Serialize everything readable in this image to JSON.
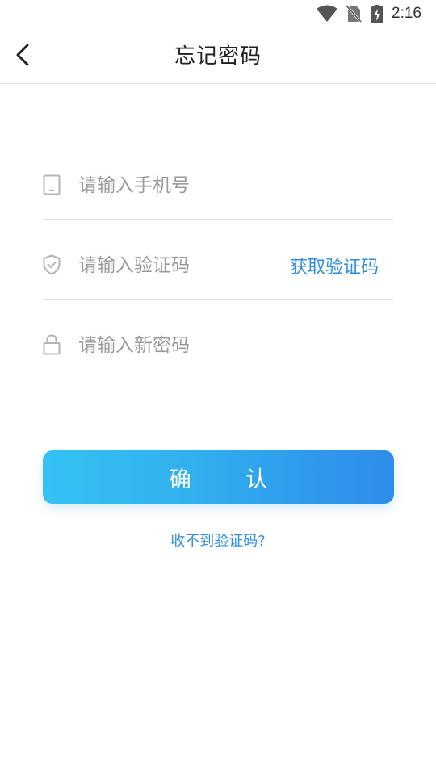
{
  "status_bar": {
    "time": "2:16",
    "icons": [
      "wifi-icon",
      "no-sim-icon",
      "battery-charging-icon"
    ]
  },
  "nav": {
    "title": "忘记密码",
    "back_icon": "chevron-left-icon"
  },
  "form": {
    "phone": {
      "placeholder": "请输入手机号",
      "value": "",
      "icon": "phone-icon"
    },
    "code": {
      "placeholder": "请输入验证码",
      "value": "",
      "icon": "shield-check-icon",
      "get_code_label": "获取验证码"
    },
    "password": {
      "placeholder": "请输入新密码",
      "value": "",
      "icon": "lock-icon"
    }
  },
  "confirm_label": "确 认",
  "no_code_link": "收不到验证码?",
  "colors": {
    "accent": "#2e8fe0",
    "button_start": "#35c2f2",
    "button_end": "#2e8ee9",
    "divider": "#e2e2e2",
    "placeholder": "#9a9a9a"
  }
}
